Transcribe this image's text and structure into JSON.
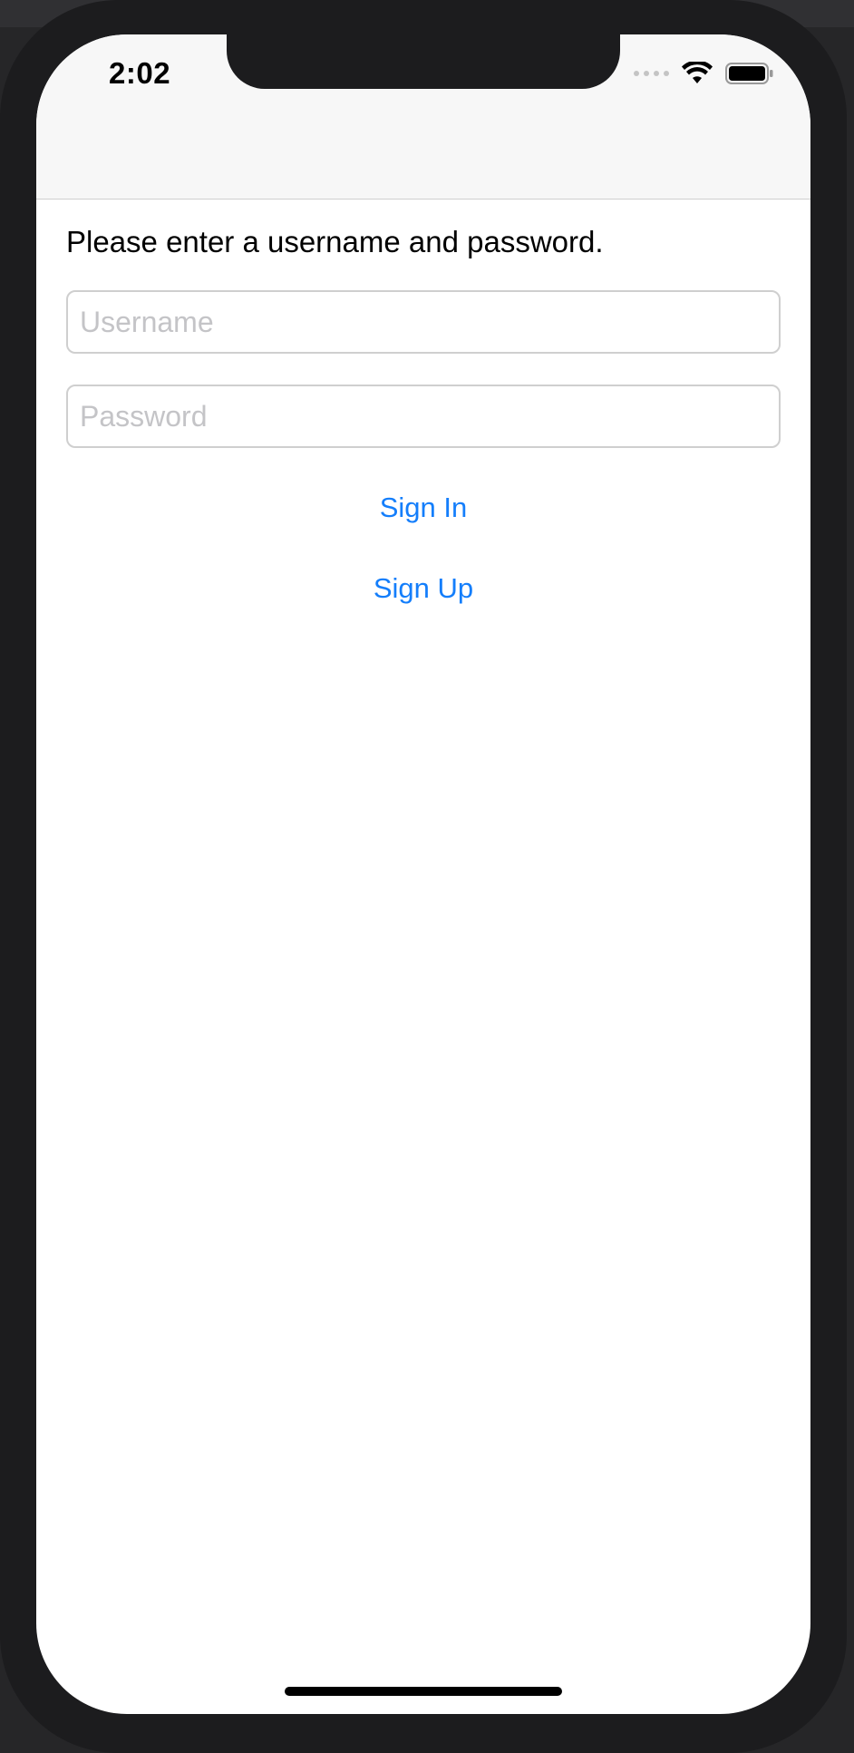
{
  "status_bar": {
    "time": "2:02"
  },
  "login": {
    "prompt": "Please enter a username and password.",
    "username_placeholder": "Username",
    "password_placeholder": "Password",
    "sign_in_label": "Sign In",
    "sign_up_label": "Sign Up"
  },
  "colors": {
    "accent": "#147efb",
    "frame": "#1c1c1e"
  },
  "icons": [
    "signal-icon",
    "wifi-icon",
    "battery-icon"
  ]
}
